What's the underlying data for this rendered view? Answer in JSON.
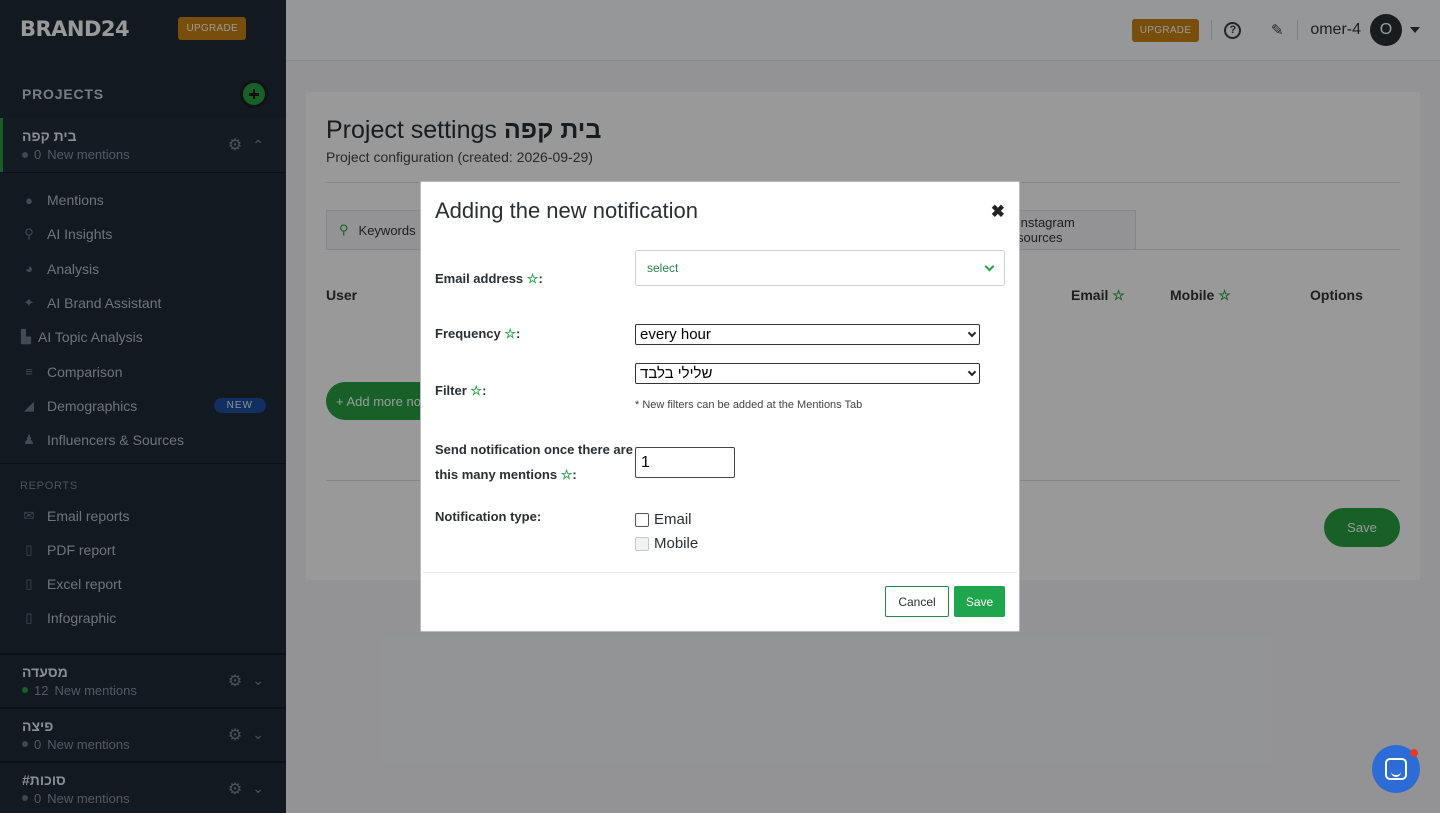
{
  "colors": {
    "accent": "#27a245",
    "upgrade": "#c98312",
    "sidebar_bg": "#1e2a38",
    "new_badge": "#1d4fa0"
  },
  "sidebar": {
    "brand": "BRAND24",
    "upgrade_label": "UPGRADE",
    "projects_title": "PROJECTS",
    "active_project": {
      "name": "בית קפה",
      "count": "0",
      "count_label": "New mentions"
    },
    "menu": [
      {
        "label": "Mentions",
        "icon": "chat-bubble-icon"
      },
      {
        "label": "AI Insights",
        "icon": "search-icon"
      },
      {
        "label": "Analysis",
        "icon": "pie-chart-icon"
      },
      {
        "label": "AI Brand Assistant",
        "icon": "sparkle-icon"
      },
      {
        "label": "AI Topic Analysis",
        "icon": "bar-chart-icon"
      },
      {
        "label": "Comparison",
        "icon": "list-icon"
      },
      {
        "label": "Demographics",
        "icon": "chart-icon",
        "badge": "NEW"
      },
      {
        "label": "Influencers & Sources",
        "icon": "person-icon"
      }
    ],
    "reports_label": "REPORTS",
    "reports": [
      {
        "label": "Email reports",
        "icon": "envelope-icon"
      },
      {
        "label": "PDF report",
        "icon": "pdf-file-icon"
      },
      {
        "label": "Excel report",
        "icon": "excel-file-icon"
      },
      {
        "label": "Infographic",
        "icon": "image-file-icon"
      }
    ],
    "other_projects": [
      {
        "name": "מסעדה",
        "count": "12",
        "count_label": "New mentions"
      },
      {
        "name": "פיצה",
        "count": "0",
        "count_label": "New mentions"
      },
      {
        "name": "#סוכות",
        "count": "0",
        "count_label": "New mentions"
      }
    ]
  },
  "topbar": {
    "upgrade_label": "UPGRADE",
    "username": "omer-4",
    "avatar_letter": "O"
  },
  "page": {
    "title": "Project settings",
    "title_project": "בית קפה",
    "subtitle": "Project configuration (created: 2026-09-29)",
    "tabs": {
      "keywords": "Keywords",
      "instagram": "Instagram sources"
    },
    "table_headers": {
      "user": "User",
      "email": "Email",
      "mobile": "Mobile",
      "options": "Options"
    },
    "add_more_label": "+ Add more notifications",
    "save_label": "Save"
  },
  "modal": {
    "title": "Adding the new notification",
    "close_symbol": "✖",
    "star": "☆",
    "email_label": "Email address",
    "email_placeholder": "select",
    "frequency_label": "Frequency",
    "frequency_value": "every hour",
    "filter_label": "Filter",
    "filter_value": "שלילי בלבד",
    "filter_note": "* New filters can be added at the Mentions Tab",
    "threshold_label_line1": "Send notification once there are",
    "threshold_label_line2": "this many mentions",
    "threshold_value": "1",
    "type_label": "Notification type:",
    "type_options": [
      "Email",
      "Mobile"
    ],
    "cancel_label": "Cancel",
    "save_label": "Save"
  }
}
